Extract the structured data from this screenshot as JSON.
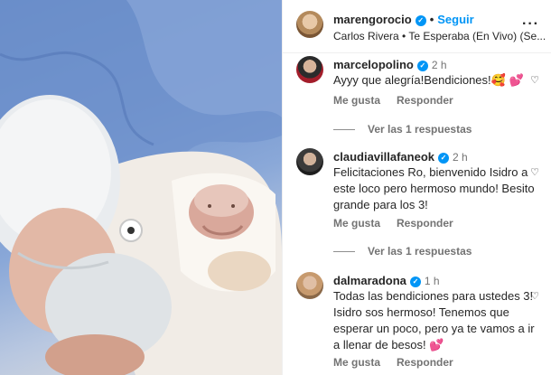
{
  "post": {
    "username": "marengorocio",
    "follow_label": "Seguir",
    "song": "Carlos Rivera • Te Esperaba (En Vivo) (Se...",
    "more_icon": "more-options-icon"
  },
  "comments": [
    {
      "username": "marcelopolino",
      "time": "2 h",
      "text": "Ayyy que alegría!Bendiciones!🥰 💕",
      "like_label": "Me gusta",
      "reply_label": "Responder",
      "replies_label": "Ver las 1 respuestas"
    },
    {
      "username": "claudiavillafaneok",
      "time": "2 h",
      "text": "Felicitaciones Ro, bienvenido Isidro a este loco pero hermoso mundo! Besito grande para los 3!",
      "like_label": "Me gusta",
      "reply_label": "Responder",
      "replies_label": "Ver las 1 respuestas"
    },
    {
      "username": "dalmaradona",
      "time": "1 h",
      "text": "Todas las bendiciones para ustedes 3! Isidro sos hermoso! Tenemos que esperar un poco, pero ya te vamos a ir a llenar de besos! 💕",
      "like_label": "Me gusta",
      "reply_label": "Responder"
    }
  ],
  "colors": {
    "accent": "#0095f6",
    "muted": "#737373"
  }
}
